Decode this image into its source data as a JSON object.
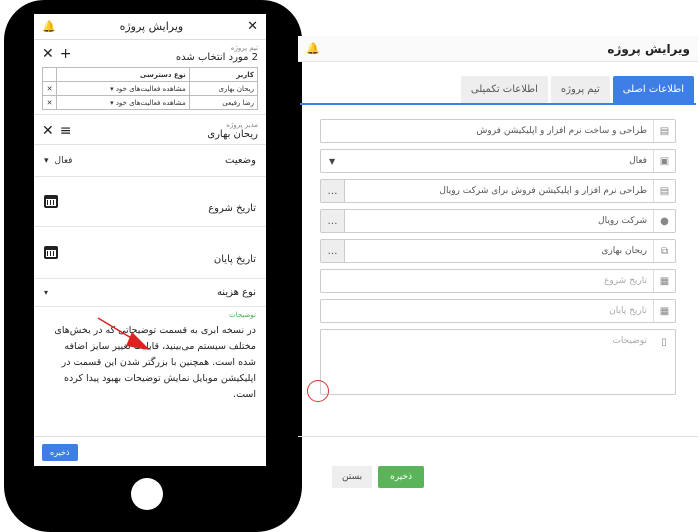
{
  "title": "ویرایش پروژه",
  "mobile": {
    "team_label": "تیم پروژه",
    "team_value": "2 مورد انتخاب شده",
    "table": {
      "headers": [
        "کاربر",
        "نوع دسترسی"
      ],
      "rows": [
        {
          "user": "ریحان بهاری",
          "access": "مشاهده فعالیت‌های خود"
        },
        {
          "user": "رضا رفیعی",
          "access": "مشاهده فعالیت‌های خود"
        }
      ]
    },
    "manager_label": "مدیر پروژه",
    "manager_value": "ریحان بهاری",
    "status_label": "وضعیت",
    "status_value": "فعال",
    "start_label": "تاریخ شروع",
    "end_label": "تاریخ پایان",
    "cost_label": "نوع هزینه",
    "desc_label": "توضیحات",
    "desc_text": "در نسخه ابری به قسمت توضیحاتی که در بخش‌های مختلف سیستم می‌بینید، قابلیت تغییر سایز اضافه شده است. همچنین با بزرگتر شدن این قسمت در اپلیکیشن موبایل نمایش توضیحات بهبود پیدا کرده است.",
    "save_label": "ذخیره"
  },
  "desktop": {
    "tabs": [
      "اطلاعات اصلی",
      "تیم پروژه",
      "اطلاعات تکمیلی"
    ],
    "fields": {
      "name": "طراحی و ساخت نرم افزار و اپلیکیشن فروش",
      "status": "فعال",
      "project": "طراحی نرم افزار و اپلیکیشن فروش برای شرکت رویال",
      "company": "شرکت رویال",
      "manager": "ریحان بهاری",
      "start_placeholder": "تاریخ شروع",
      "end_placeholder": "تاریخ پایان",
      "desc_placeholder": "توضیحات"
    },
    "save_label": "ذخیره",
    "close_label": "بستن"
  },
  "colors": {
    "accent": "#3f7fe5",
    "save": "#5ab55a",
    "bell": "#2e9b3a"
  }
}
